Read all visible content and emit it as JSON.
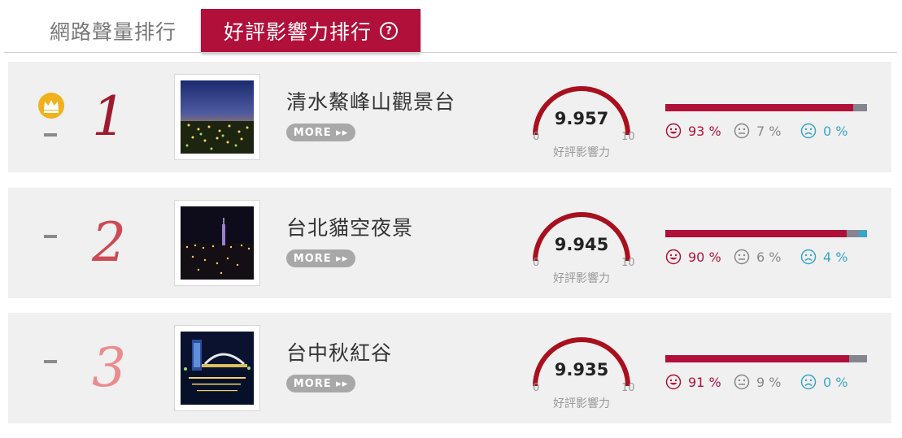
{
  "tabs": [
    {
      "label": "網路聲量排行",
      "active": false
    },
    {
      "label": "好評影響力排行",
      "active": true
    }
  ],
  "help_icon": "?",
  "colors": {
    "accent": "#b0103a",
    "neutral": "#858590",
    "negative": "#3aa5c6",
    "rank1": "#9e1b2e",
    "rank2": "#cc4b55",
    "rank3": "#ea8c8f"
  },
  "gauge_label": "好評影響力",
  "gauge_min": "0",
  "gauge_max": "10",
  "more_label": "MORE ▸▸",
  "items": [
    {
      "rank": "1",
      "name": "清水鰲峰山觀景台",
      "score": "9.957",
      "positive": "93 %",
      "neutral": "7 %",
      "negative": "0 %",
      "icon": "crown-icon"
    },
    {
      "rank": "2",
      "name": "台北貓空夜景",
      "score": "9.945",
      "positive": "90 %",
      "neutral": "6 %",
      "negative": "4 %"
    },
    {
      "rank": "3",
      "name": "台中秋紅谷",
      "score": "9.935",
      "positive": "91 %",
      "neutral": "9 %",
      "negative": "0 %"
    }
  ]
}
